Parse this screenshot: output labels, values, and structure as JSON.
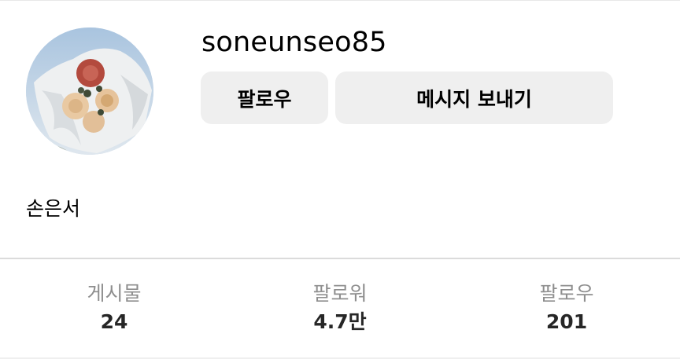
{
  "profile": {
    "username": "soneunseo85",
    "full_name": "손은서",
    "avatar_description": "profile-photo"
  },
  "actions": {
    "follow_label": "팔로우",
    "message_label": "메시지 보내기"
  },
  "stats": [
    {
      "label": "게시물",
      "value": "24"
    },
    {
      "label": "팔로워",
      "value": "4.7만"
    },
    {
      "label": "팔로우",
      "value": "201"
    }
  ],
  "colors": {
    "button_bg": "#efefef",
    "stat_label": "#8e8e8e",
    "divider": "#dbdbdb"
  }
}
